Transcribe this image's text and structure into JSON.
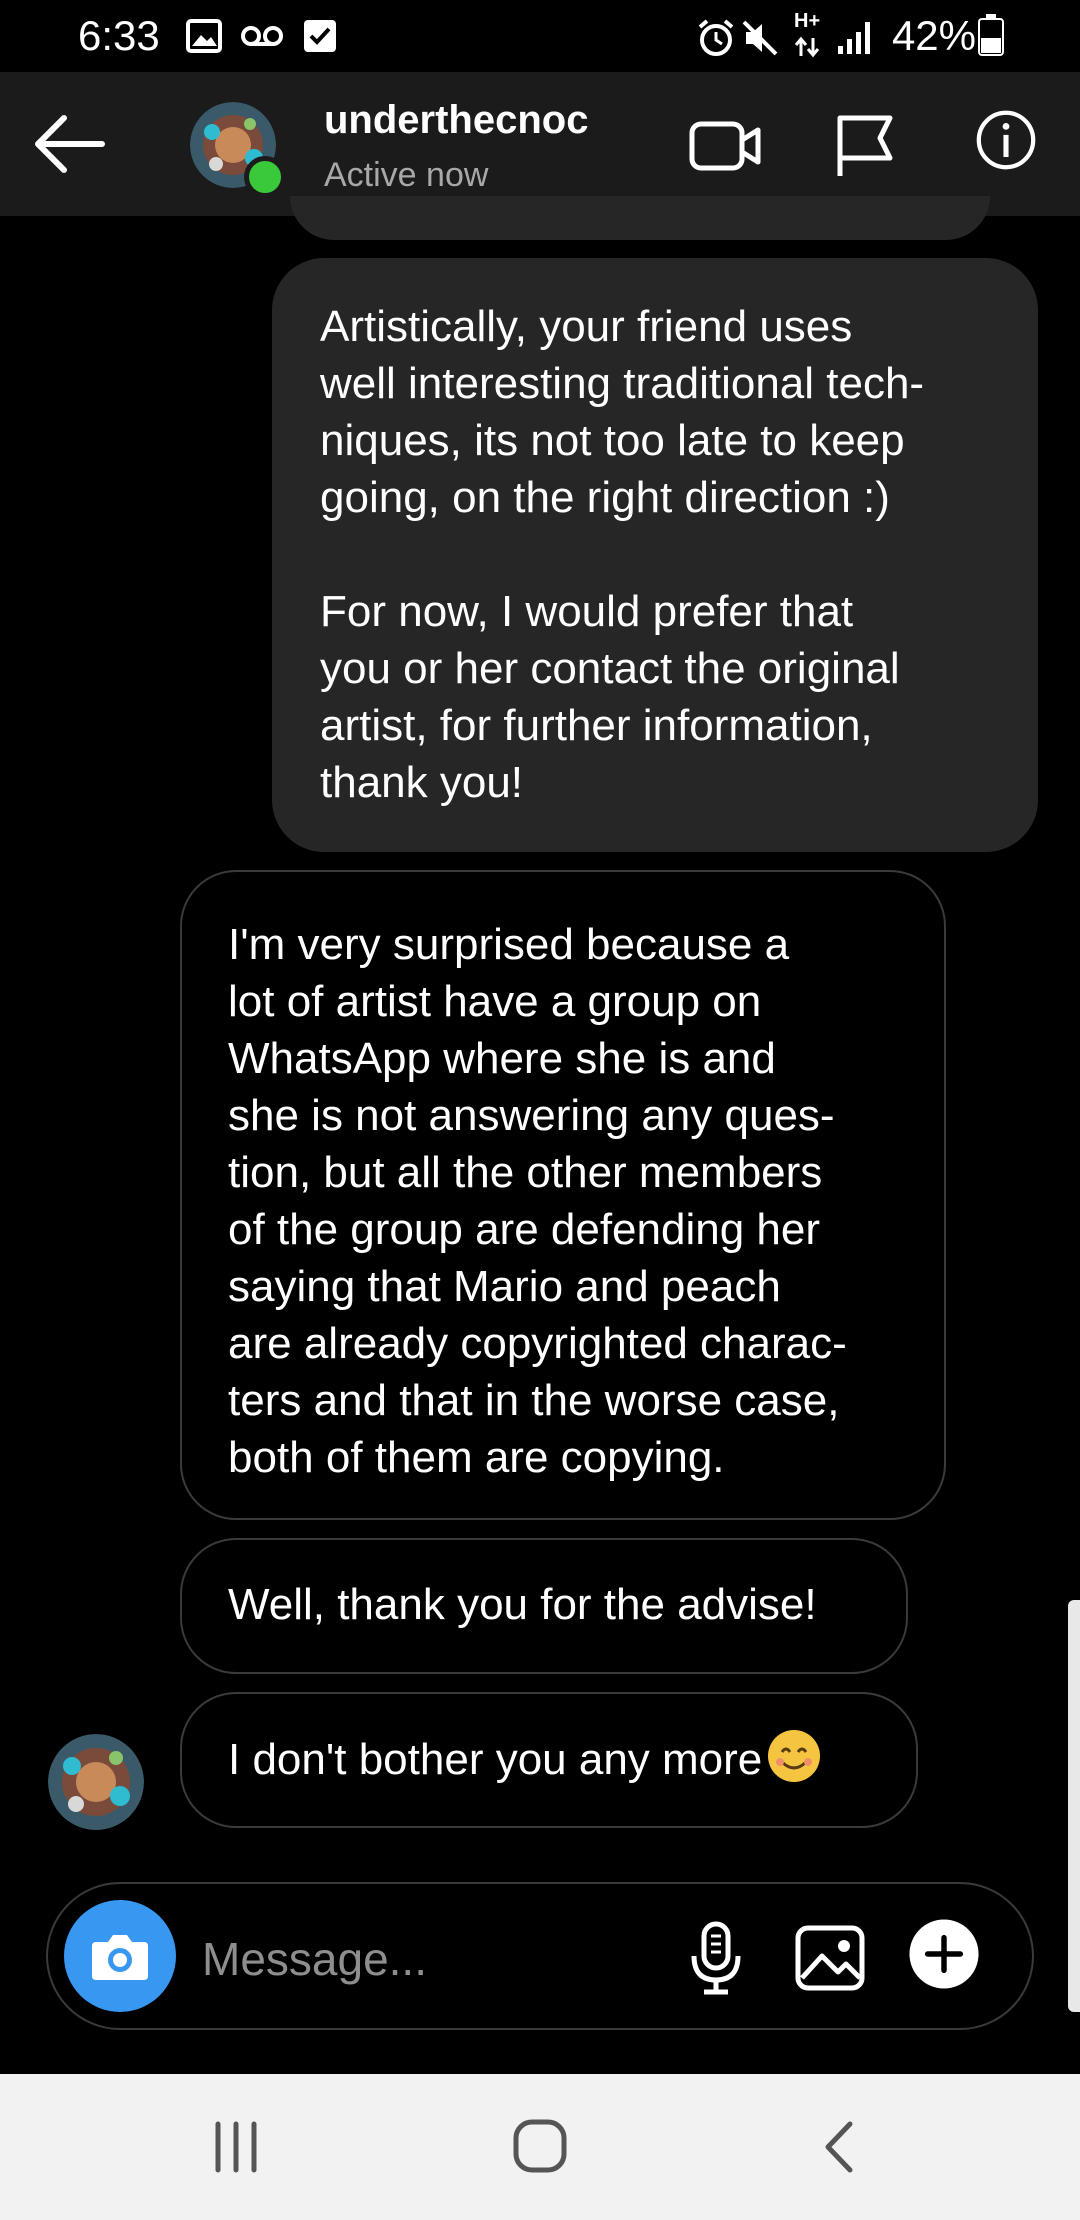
{
  "status_bar": {
    "time": "6:33",
    "battery": "42%",
    "network": "H+",
    "icons": [
      "image-icon",
      "voicemail-icon",
      "check-box-icon",
      "alarm-icon",
      "mute-icon",
      "data-arrows-icon",
      "signal-icon",
      "battery-icon"
    ]
  },
  "header": {
    "username": "underthecnoc",
    "status": "Active now",
    "icons": [
      "back-arrow-icon",
      "video-call-icon",
      "flag-icon",
      "info-icon"
    ]
  },
  "messages": [
    {
      "from": "me",
      "text": "Artistically, your friend uses\nwell interesting traditional tech-\nniques, its not too late to keep\ngoing, on the right direction :)\n\nFor now, I would prefer that\nyou or her contact the original\nartist, for further information,\nthank you!"
    },
    {
      "from": "them",
      "text": "I'm very surprised because a\nlot of artist have a group on\nWhatsApp where she is and\nshe is not answering any ques-\ntion, but all the other members\nof the group are defending her\nsaying that Mario and peach\nare already copyrighted charac-\nters and that in the worse case,\nboth of them are copying."
    },
    {
      "from": "them",
      "text": "Well, thank you for the advise!"
    },
    {
      "from": "them",
      "text": "I don't bother you any more",
      "emoji": "smiling-face-emoji"
    }
  ],
  "composer": {
    "placeholder": "Message...",
    "icons": [
      "camera-icon",
      "microphone-icon",
      "gallery-icon",
      "plus-icon"
    ]
  },
  "nav_bar": {
    "icons": [
      "recent-apps-icon",
      "home-icon",
      "back-icon"
    ]
  },
  "colors": {
    "sent_bubble": "#262626",
    "header_bg": "#1b1b1b",
    "camera_button": "#3897f0",
    "online_dot": "#3ac93a"
  }
}
